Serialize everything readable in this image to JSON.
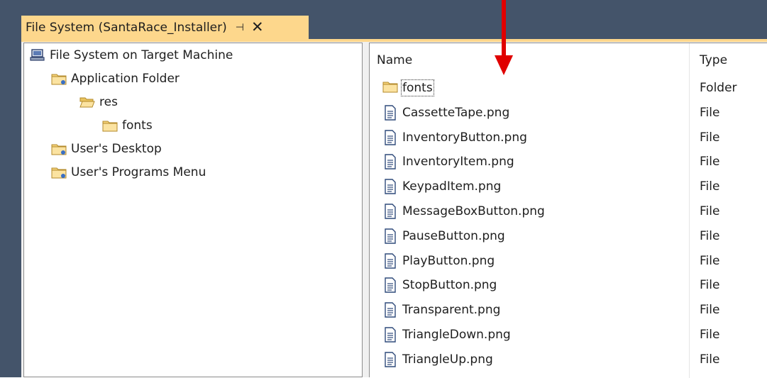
{
  "tab": {
    "title": "File System (SantaRace_Installer)",
    "pin_glyph": "⊣",
    "close_glyph": "✕"
  },
  "tree": {
    "items": [
      {
        "label": "File System on Target Machine",
        "icon": "computer-icon",
        "level": 0
      },
      {
        "label": "Application Folder",
        "icon": "special-folder-icon",
        "level": 1
      },
      {
        "label": "res",
        "icon": "open-folder-icon",
        "level": 2
      },
      {
        "label": "fonts",
        "icon": "folder-icon",
        "level": 3
      },
      {
        "label": "User's Desktop",
        "icon": "special-folder-icon",
        "level": 1
      },
      {
        "label": "User's Programs Menu",
        "icon": "special-folder-icon",
        "level": 1
      }
    ]
  },
  "list": {
    "columns": {
      "name": "Name",
      "type": "Type"
    },
    "rows": [
      {
        "name": "fonts",
        "type": "Folder",
        "icon": "folder-icon"
      },
      {
        "name": "CassetteTape.png",
        "type": "File",
        "icon": "file-icon"
      },
      {
        "name": "InventoryButton.png",
        "type": "File",
        "icon": "file-icon"
      },
      {
        "name": "InventoryItem.png",
        "type": "File",
        "icon": "file-icon"
      },
      {
        "name": "KeypadItem.png",
        "type": "File",
        "icon": "file-icon"
      },
      {
        "name": "MessageBoxButton.png",
        "type": "File",
        "icon": "file-icon"
      },
      {
        "name": "PauseButton.png",
        "type": "File",
        "icon": "file-icon"
      },
      {
        "name": "PlayButton.png",
        "type": "File",
        "icon": "file-icon"
      },
      {
        "name": "StopButton.png",
        "type": "File",
        "icon": "file-icon"
      },
      {
        "name": "Transparent.png",
        "type": "File",
        "icon": "file-icon"
      },
      {
        "name": "TriangleDown.png",
        "type": "File",
        "icon": "file-icon"
      },
      {
        "name": "TriangleUp.png",
        "type": "File",
        "icon": "file-icon"
      }
    ]
  },
  "colors": {
    "tab": "#fdd78c",
    "frame": "#44546a",
    "arrow": "#e00000",
    "folder": "#f5d37a"
  }
}
